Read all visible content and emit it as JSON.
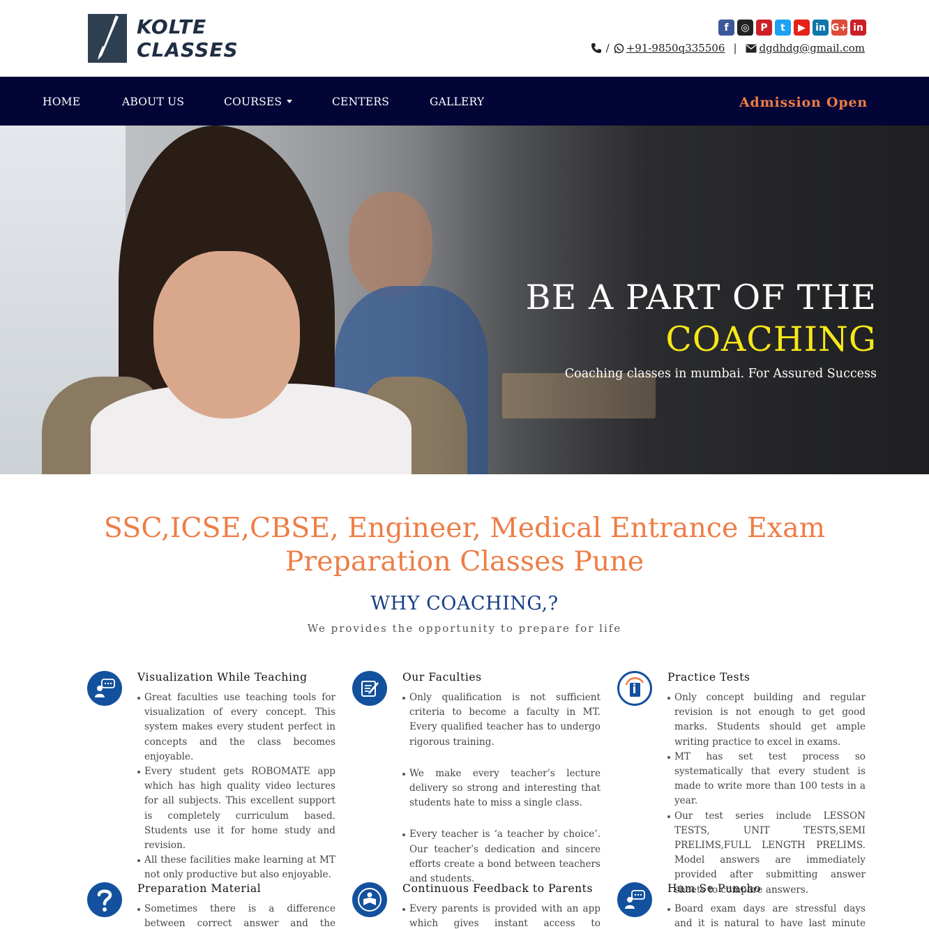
{
  "brand": {
    "logo_line1": "KOLTE",
    "logo_line2": "CLASSES"
  },
  "social_icons": [
    {
      "name": "facebook-icon",
      "glyph": "f",
      "color": "#3b5998"
    },
    {
      "name": "instagram-icon",
      "glyph": "◎",
      "color": "#222222"
    },
    {
      "name": "pinterest-icon",
      "glyph": "P",
      "color": "#cb2027"
    },
    {
      "name": "twitter-icon",
      "glyph": "t",
      "color": "#1da1f2"
    },
    {
      "name": "youtube-icon",
      "glyph": "▶",
      "color": "#e62117"
    },
    {
      "name": "linkedin-icon",
      "glyph": "in",
      "color": "#0e76a8"
    },
    {
      "name": "google-plus-icon",
      "glyph": "G+",
      "color": "#dd4b39"
    },
    {
      "name": "linkedin-icon-2",
      "glyph": "in",
      "color": "#cb2027"
    }
  ],
  "contact": {
    "separator": "/",
    "phone": "+91-9850q335506",
    "divider": "|",
    "email": "dgdhdg@gmail.com"
  },
  "nav": {
    "home": "HOME",
    "about": "ABOUT US",
    "courses": "COURSES",
    "centers": "CENTERS",
    "gallery": "GALLERY",
    "admission": "Admission Open"
  },
  "hero": {
    "line1": "BE A PART OF THE",
    "line2": "COACHING",
    "subtitle": "Coaching classes in mumbai. For Assured Success"
  },
  "main": {
    "title_line1": "SSC,ICSE,CBSE, Engineer, Medical Entrance Exam",
    "title_line2": "Preparation Classes Pune",
    "why_title": "WHY COACHING,?",
    "why_subtitle": "We provides the opportunity to prepare for life"
  },
  "features": [
    {
      "icon": "chat-teacher-icon",
      "title": "Visualization While Teaching",
      "items": [
        "Great faculties use teaching tools for visualization of every concept. This system makes every student perfect in concepts and the class becomes enjoyable.",
        "Every student gets ROBOMATE app which has high quality video lectures for all subjects. This excellent support is completely curriculum based. Students use it for home study and revision.",
        "All these facilities make learning at MT not only productive but also enjoyable."
      ]
    },
    {
      "icon": "edit-document-icon",
      "title": "Our Faculties",
      "items": [
        "Only qualification is not sufficient criteria to become a faculty in MT. Every qualified teacher has to undergo rigorous training.",
        "We make every teacher’s lecture delivery so strong and interesting that students hate to miss a single class.",
        "Every teacher is ‘a teacher by choice’. Our teacher’s dedication and sincere efforts create a bond between teachers and students."
      ]
    },
    {
      "icon": "book-info-icon",
      "title": "Practice Tests",
      "items": [
        "Only concept building and regular revision is not enough to get good marks. Students should get ample writing practice to excel in exams.",
        "MT has set test process so systematically that every student is made to write more than 100 tests in a year.",
        "Our test series include LESSON TESTS, UNIT TESTS,SEMI PRELIMS,FULL LENGTH PRELIMS. Model answers are immediately provided after submitting answer sheets to compare answers."
      ]
    },
    {
      "icon": "question-mark-icon",
      "title": "Preparation Material",
      "items": [
        "Sometimes there is a difference between correct answer and the answer as per"
      ]
    },
    {
      "icon": "reading-student-icon",
      "title": "Continuous Feedback to Parents",
      "items": [
        "Every parents is provided with an app which gives instant access to attendance,"
      ]
    },
    {
      "icon": "chat-teacher-icon",
      "title": "Hum Se Puncho",
      "items": [
        "Board exam days are stressful days and it is natural to have last minute doubts."
      ]
    }
  ]
}
